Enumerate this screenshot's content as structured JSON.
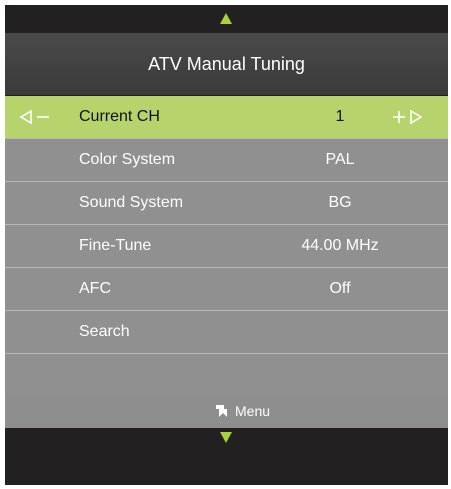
{
  "header": {
    "title": "ATV Manual Tuning"
  },
  "rows": [
    {
      "label": "Current CH",
      "value": "1"
    },
    {
      "label": "Color System",
      "value": "PAL"
    },
    {
      "label": "Sound System",
      "value": "BG"
    },
    {
      "label": "Fine-Tune",
      "value": "44.00 MHz"
    },
    {
      "label": "AFC",
      "value": "Off"
    },
    {
      "label": "Search",
      "value": ""
    }
  ],
  "footer": {
    "menu_label": "Menu",
    "back_icon": "return-icon"
  },
  "nav": {
    "up_icon": "triangle-up-icon",
    "down_icon": "triangle-down-icon"
  },
  "colors": {
    "accent": "#a8d23c",
    "selected_row": "#b7d36c",
    "row_bg": "#909090",
    "frame_bg": "#222021"
  }
}
